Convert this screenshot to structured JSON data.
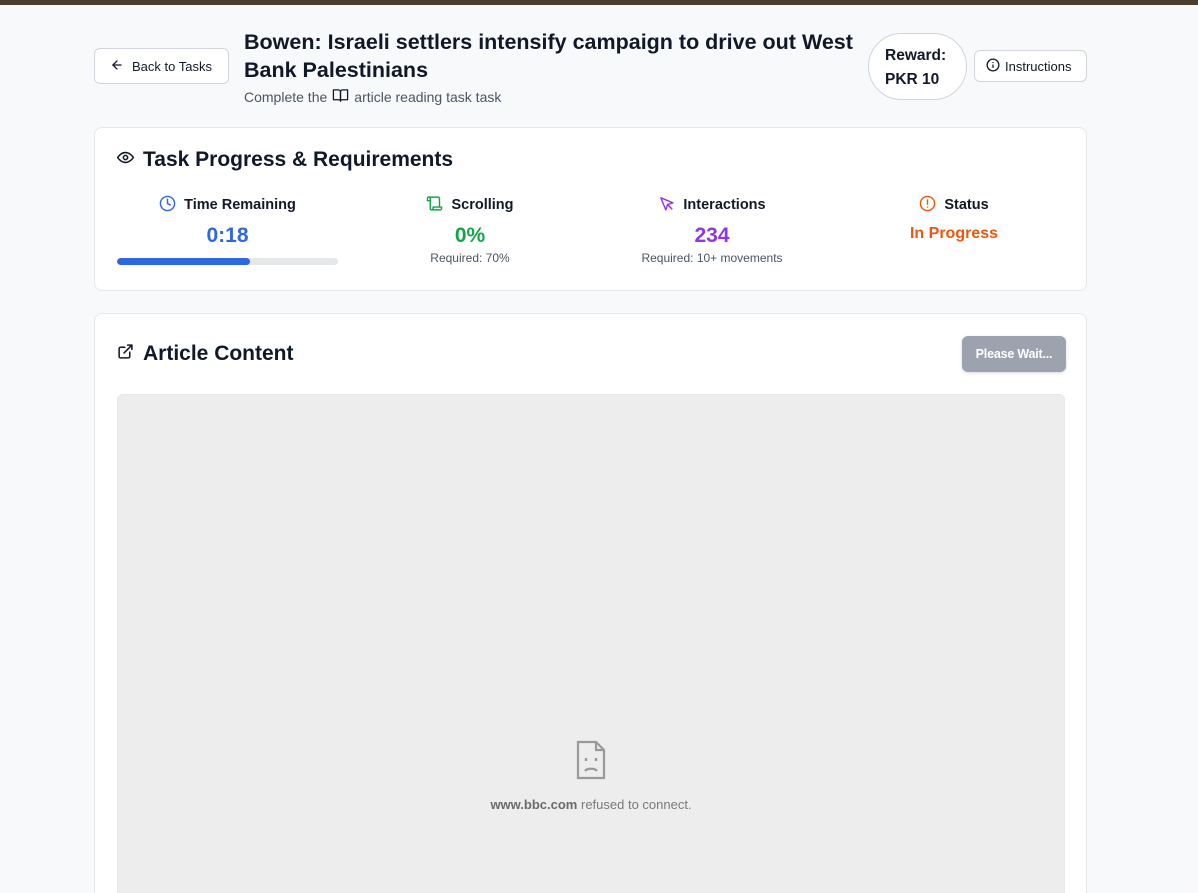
{
  "header": {
    "back_label": "Back to Tasks",
    "title": "Bowen: Israeli settlers intensify campaign to drive out West Bank Palestinians",
    "subtitle_prefix": "Complete the",
    "subtitle_suffix": "article reading task task",
    "reward_label": "Reward:",
    "reward_value": "PKR 10",
    "instructions_label": "Instructions"
  },
  "progress": {
    "title": "Task Progress & Requirements",
    "metrics": [
      {
        "label": "Time Remaining",
        "value": "0:18",
        "color": "#2f67de",
        "bar_fraction": 0.6
      },
      {
        "label": "Scrolling",
        "value": "0%",
        "requirement": "Required: 70%",
        "color": "#16a34a"
      },
      {
        "label": "Interactions",
        "value": "234",
        "requirement": "Required: 10+ movements",
        "color": "#9333ea"
      },
      {
        "label": "Status",
        "value": "In Progress",
        "color": "#ea580c"
      }
    ]
  },
  "article": {
    "title": "Article Content",
    "wait_button": "Please Wait...",
    "error_domain": "www.bbc.com",
    "error_message": "refused to connect."
  },
  "icons": {
    "back": "arrow-left-icon",
    "subtitle": "book-icon",
    "instructions": "info-icon",
    "progress": "eye-icon",
    "time": "clock-icon",
    "scrolling": "scroll-icon",
    "interactions": "cursor-icon",
    "status": "alert-circle-icon",
    "article": "external-link-icon",
    "error": "sad-document-icon"
  }
}
